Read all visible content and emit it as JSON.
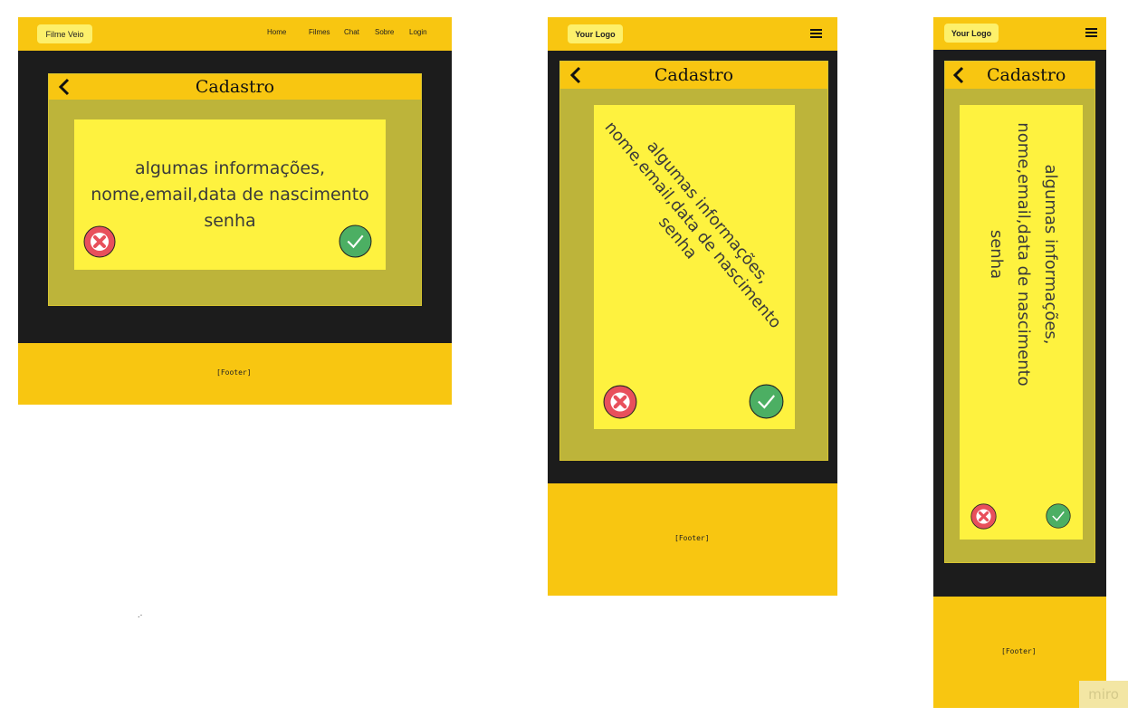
{
  "desktop": {
    "logo": "Filme Veio",
    "nav": [
      "Home",
      "Filmes",
      "Chat",
      "Sobre",
      "Login"
    ],
    "title": "Cadastro",
    "lines": [
      "algumas informações,",
      "nome,email,data de nascimento",
      "senha"
    ],
    "footer": "[Footer]"
  },
  "tablet": {
    "logo": "Your Logo",
    "title": "Cadastro",
    "lines": [
      "algumas informações,",
      "nome,email,data de nascimento",
      "senha"
    ],
    "footer": "[Footer]"
  },
  "mobile": {
    "logo": "Your Logo",
    "title": "Cadastro",
    "lines": [
      "algumas informações,",
      "nome,email,data de nascimento",
      "senha"
    ],
    "footer": "[Footer]"
  },
  "watermark": "miro",
  "colors": {
    "nav": "#f8c611",
    "frame": "#1c1c1c",
    "panel": "#bdb43a",
    "card": "#fef23f",
    "cancel": "#e8505b",
    "confirm": "#4caf63"
  },
  "icons": {
    "back": "chevron-left-icon",
    "cancel": "x-circle-icon",
    "confirm": "check-circle-icon",
    "menu": "hamburger-icon"
  }
}
